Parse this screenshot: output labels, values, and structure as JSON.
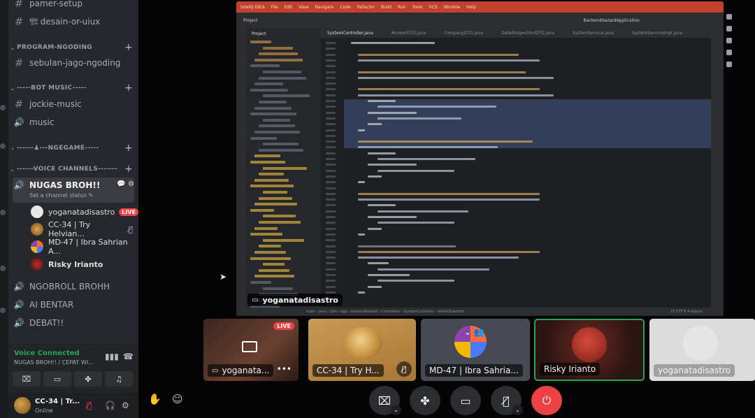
{
  "sidebar": {
    "channels_top": [
      {
        "name": "pamer-setup"
      },
      {
        "name": "desain-or-uiux",
        "emoji": "🏗"
      }
    ],
    "categories": [
      {
        "label": "PROGRAM-NGODING",
        "channels": [
          "sebulan-jago-ngoding"
        ]
      },
      {
        "label": "-----BOT MUSIC-----",
        "channels": [
          "jockie-music",
          "music"
        ]
      },
      {
        "label": "------♟---NGEGAME-----"
      },
      {
        "label": "------VOICE CHANNELS-------"
      }
    ],
    "voice_channels": {
      "active": {
        "name": "NUGAS BROH!!",
        "status_placeholder": "Set a channel status",
        "members": [
          {
            "name": "yoganatadisastro",
            "badge": "LIVE"
          },
          {
            "name": "CC-34 | Try Helvian...",
            "muted": true
          },
          {
            "name": "MD-47 | Ibra Sahrian A..."
          },
          {
            "name": "Risky Irianto"
          }
        ]
      },
      "others": [
        "NGOBROLL BROHH",
        "AI BENTAR",
        "DEBAT!!"
      ]
    },
    "voice_panel": {
      "status": "Voice Connected",
      "channel": "NUGAS BROH!! / CEPAT WI..."
    },
    "user_panel": {
      "name": "CC-34 | Tr...",
      "status": "Online"
    }
  },
  "stage": {
    "shared_screen": {
      "sharer_label": "yoganatadisastro",
      "ide_menu": [
        "IntelliJ IDEA",
        "File",
        "Edit",
        "View",
        "Navigate",
        "Code",
        "Refactor",
        "Build",
        "Run",
        "Tools",
        "VCS",
        "Window",
        "Help"
      ],
      "ide_project": "Project",
      "ide_run_config": "BackendHazardApplication",
      "ide_tabs": [
        "SystemController.java",
        "AnswerDTO.java",
        "CompanyDTO.java",
        "DetailInspectionDTO.java",
        "SystemService.java",
        "SystemServiceImpl.java"
      ],
      "ide_breadcrumb": "main › java › com › app › backendhazard › Controllers › SystemController › deleteQuestion",
      "ide_status_right": "LF  UTF-8  4 spaces"
    },
    "tiles": [
      {
        "label": "yoganata...",
        "badge": "LIVE",
        "bg": "#5c3a2e"
      },
      {
        "label": "CC-34 | Try H...",
        "muted": true,
        "bg": "#b98b4c"
      },
      {
        "label": "MD-47 | Ibra Sahria...",
        "bg": "#4a4d55"
      },
      {
        "label": "Risky Irianto",
        "bg": "#3a1a18",
        "speaking": true
      },
      {
        "label": "yoganatadisastro",
        "bg": "#d9d9d9"
      }
    ]
  },
  "controls": [
    {
      "icon": "camera-off-icon"
    },
    {
      "icon": "activities-icon"
    },
    {
      "icon": "screen-share-icon"
    },
    {
      "icon": "mic-off-icon"
    },
    {
      "icon": "end-call-icon"
    }
  ],
  "colors": {
    "accent_live": "#ed4245",
    "voice_connected": "#23a55a",
    "ide_titlebar": "#c2412d",
    "speaking_border": "#23a55a"
  }
}
